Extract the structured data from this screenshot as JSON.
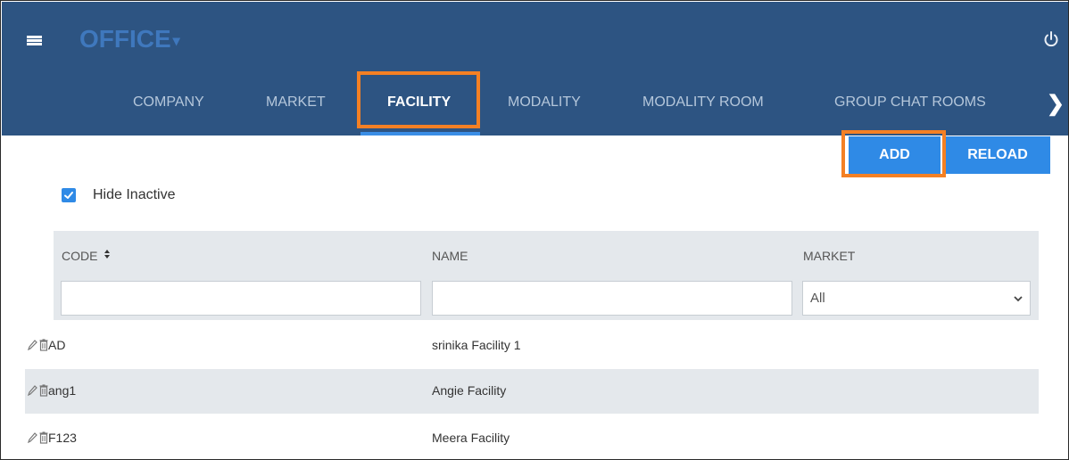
{
  "app": {
    "title": "OFFICE",
    "brand_caret": "▾"
  },
  "tabs": [
    {
      "label": "COMPANY"
    },
    {
      "label": "MARKET"
    },
    {
      "label": "FACILITY",
      "active": true
    },
    {
      "label": "MODALITY"
    },
    {
      "label": "MODALITY ROOM"
    },
    {
      "label": "GROUP CHAT ROOMS"
    }
  ],
  "tab_next": "❯",
  "actions": {
    "add_label": "ADD",
    "reload_label": "RELOAD"
  },
  "filters": {
    "hide_inactive_label": "Hide Inactive",
    "hide_inactive_checked": true
  },
  "table": {
    "columns": [
      "CODE",
      "NAME",
      "MARKET"
    ],
    "sort_indicator": "▲▼",
    "market_filter_value": "All",
    "rows": [
      {
        "code": "AD",
        "name": "srinika Facility 1",
        "market": ""
      },
      {
        "code": "ang1",
        "name": "Angie Facility",
        "market": ""
      },
      {
        "code": "F123",
        "name": "Meera Facility",
        "market": ""
      }
    ]
  },
  "colors": {
    "header_bg": "#2d5482",
    "brand": "#3f78bd",
    "accent": "#2f8ae6",
    "highlight": "#f48024",
    "table_header_bg": "#e4e8ec"
  },
  "icons": {
    "menu": "hamburger-icon",
    "power": "power-icon",
    "next": "chevron-right-icon",
    "sort": "sort-icon",
    "edit": "pencil-icon",
    "delete": "trash-icon",
    "select": "chevron-down-icon"
  }
}
